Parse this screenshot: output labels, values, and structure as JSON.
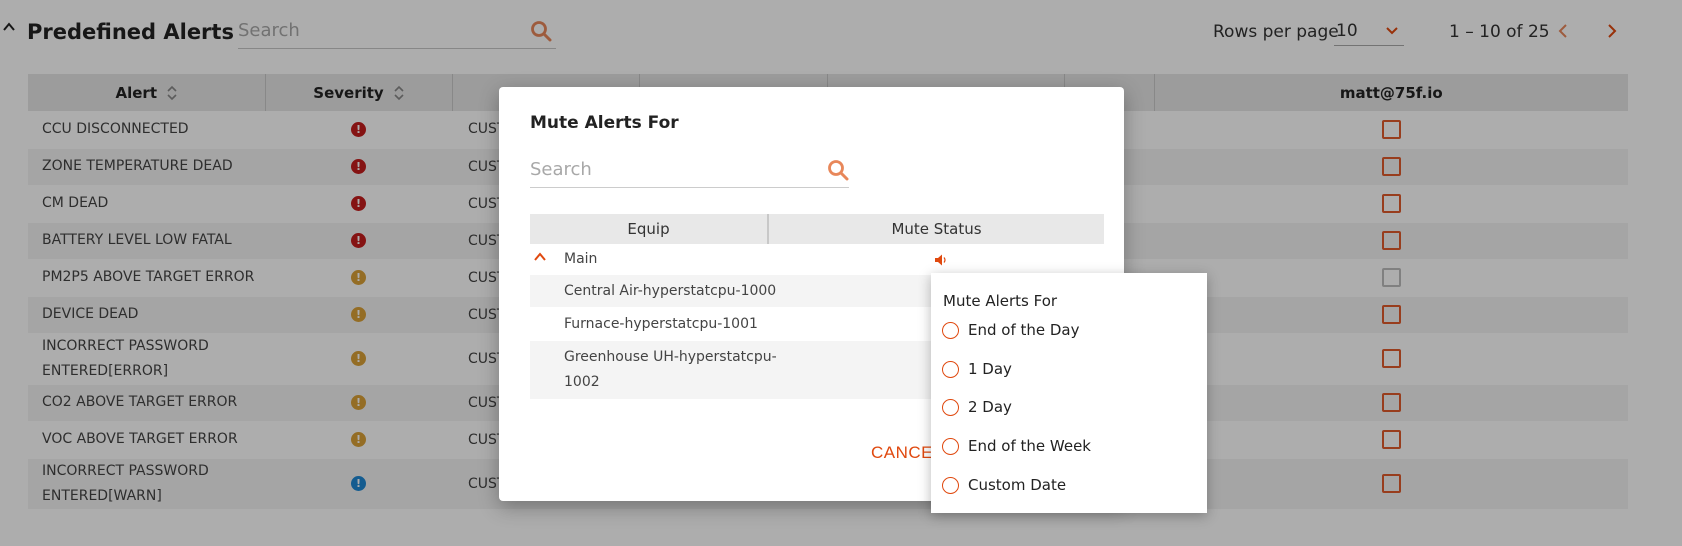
{
  "page": {
    "title": "Predefined Alerts",
    "search_placeholder": "Search",
    "rows_per_page_label": "Rows per page",
    "rows_per_page_value": "10",
    "range_label": "1 – 10 of 25"
  },
  "table": {
    "columns": [
      "Alert",
      "Severity",
      "",
      "",
      "",
      "",
      "matt@75f.io"
    ],
    "rows": [
      {
        "name": "CCU DISCONNECTED",
        "severity": "severe",
        "type": "CUST",
        "checked": false
      },
      {
        "name": "ZONE TEMPERATURE DEAD",
        "severity": "severe",
        "type": "CUST",
        "checked": false
      },
      {
        "name": "CM DEAD",
        "severity": "severe",
        "type": "CUST",
        "checked": false
      },
      {
        "name": "BATTERY LEVEL LOW FATAL",
        "severity": "severe",
        "type": "CUST",
        "checked": false
      },
      {
        "name": "PM2P5 ABOVE TARGET ERROR",
        "severity": "moderate",
        "type": "CUST",
        "checked": false,
        "disabled": true
      },
      {
        "name": "DEVICE DEAD",
        "severity": "moderate",
        "type": "CUST",
        "checked": false
      },
      {
        "name": "INCORRECT PASSWORD ENTERED[ERROR]",
        "severity": "moderate",
        "type": "CUST",
        "checked": false
      },
      {
        "name": "CO2 ABOVE TARGET ERROR",
        "severity": "moderate",
        "type": "CUST",
        "checked": false
      },
      {
        "name": "VOC ABOVE TARGET ERROR",
        "severity": "moderate",
        "type": "CUST",
        "checked": false
      },
      {
        "name": "INCORRECT PASSWORD ENTERED[WARN]",
        "severity": "low",
        "type": "CUST",
        "checked": false
      }
    ]
  },
  "severity_colors": {
    "severe": "#c41c1c",
    "moderate": "#dba137",
    "low": "#1e88d4"
  },
  "severity_symbol": "!",
  "accent_color": "#e0490f",
  "modal": {
    "title": "Mute Alerts For",
    "search_placeholder": "Search",
    "columns": [
      "Equip",
      "Mute Status"
    ],
    "group": "Main",
    "equips": [
      "Central Air-hyperstatcpu-1000",
      "Furnace-hyperstatcpu-1001",
      "Greenhouse UH-hyperstatcpu-1002"
    ],
    "cancel_label": "CANCE"
  },
  "popover": {
    "title": "Mute Alerts For",
    "options": [
      "End of the Day",
      "1 Day",
      "2 Day",
      "End of the Week",
      "Custom Date"
    ]
  },
  "icons": {
    "search": "search-icon",
    "sort": "sort-icon",
    "speaker": "speaker-icon",
    "caret_up": "chevron-up-icon",
    "caret_down": "chevron-down-icon",
    "prev": "chevron-left-icon",
    "next": "chevron-right-icon"
  }
}
